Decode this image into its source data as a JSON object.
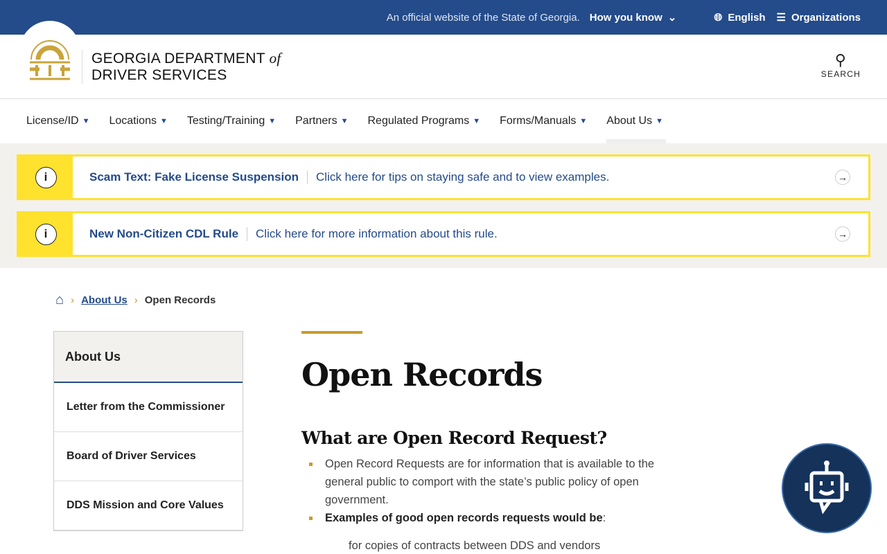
{
  "topbar": {
    "official": "An official website of the State of Georgia.",
    "how": "How you know",
    "language": "English",
    "organizations": "Organizations"
  },
  "header": {
    "brand_line1": "GEORGIA DEPARTMENT",
    "brand_of": "of",
    "brand_line2": "DRIVER SERVICES",
    "search": "SEARCH"
  },
  "nav": [
    "License/ID",
    "Locations",
    "Testing/Training",
    "Partners",
    "Regulated Programs",
    "Forms/Manuals",
    "About Us"
  ],
  "alerts": [
    {
      "title": "Scam Text: Fake License Suspension",
      "desc": "Click here for tips on staying safe and to view examples."
    },
    {
      "title": "New Non-Citizen CDL Rule",
      "desc": "Click here for more information about this rule."
    }
  ],
  "breadcrumb": {
    "parent": "About Us",
    "current": "Open Records"
  },
  "sidebar": {
    "heading": "About Us",
    "items": [
      "Letter from the Commissioner",
      "Board of Driver Services",
      "DDS Mission and Core Values"
    ]
  },
  "main": {
    "title": "Open Records",
    "subtitle": "What are Open Record Request?",
    "bullet1": "Open Record Requests are for information that is available to the general public to comport with the state’s public policy of open government.",
    "bullet2": "Examples of good open records requests would be",
    "bullet2_suffix": ":",
    "sub1": "for copies of contracts between DDS and vendors"
  }
}
